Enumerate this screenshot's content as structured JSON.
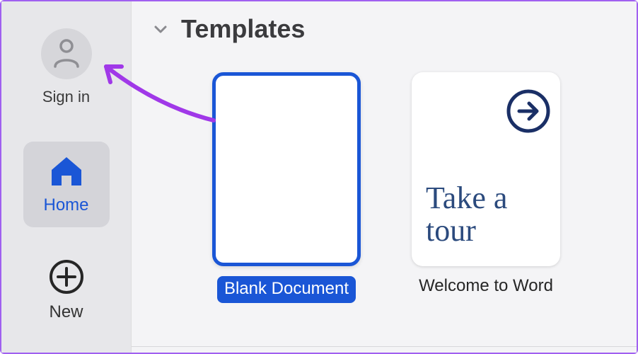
{
  "sidebar": {
    "signin_label": "Sign in",
    "nav": [
      {
        "label": "Home",
        "active": true
      },
      {
        "label": "New",
        "active": false
      }
    ]
  },
  "header": {
    "title": "Templates"
  },
  "templates": [
    {
      "label": "Blank Document",
      "selected": true,
      "kind": "blank"
    },
    {
      "label": "Welcome to Word",
      "selected": false,
      "kind": "tour",
      "tour_text": "Take a tour"
    }
  ],
  "colors": {
    "accent": "#1a56d6",
    "annotation": "#a038e8"
  }
}
